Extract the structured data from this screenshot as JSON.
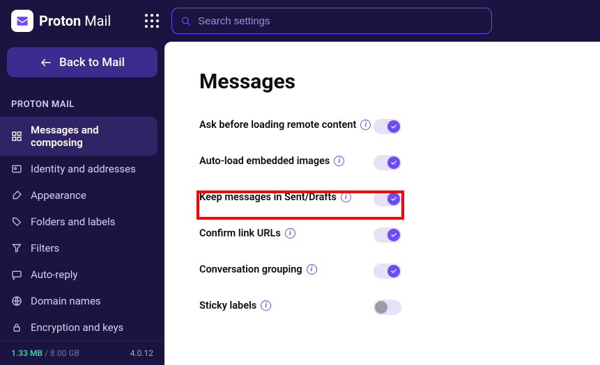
{
  "brand": {
    "name_a": "Proton",
    "name_b": "Mail"
  },
  "search": {
    "placeholder": "Search settings",
    "value": ""
  },
  "back_button": "Back to Mail",
  "section": "PROTON MAIL",
  "nav": [
    {
      "label": "Messages and composing"
    },
    {
      "label": "Identity and addresses"
    },
    {
      "label": "Appearance"
    },
    {
      "label": "Folders and labels"
    },
    {
      "label": "Filters"
    },
    {
      "label": "Auto-reply"
    },
    {
      "label": "Domain names"
    },
    {
      "label": "Encryption and keys"
    }
  ],
  "storage": {
    "used": "1.33 MB",
    "sep": " / ",
    "total": "8.00 GB"
  },
  "version": "4.0.12",
  "page": {
    "title": "Messages"
  },
  "settings": [
    {
      "label": "Ask before loading remote content",
      "info": true,
      "on": true
    },
    {
      "label": "Auto-load embedded images",
      "info": true,
      "on": true
    },
    {
      "label": "Keep messages in Sent/Drafts",
      "info": true,
      "on": true
    },
    {
      "label": "Confirm link URLs",
      "info": true,
      "on": true
    },
    {
      "label": "Conversation grouping",
      "info": true,
      "on": true
    },
    {
      "label": "Sticky labels",
      "info": true,
      "on": false
    }
  ]
}
